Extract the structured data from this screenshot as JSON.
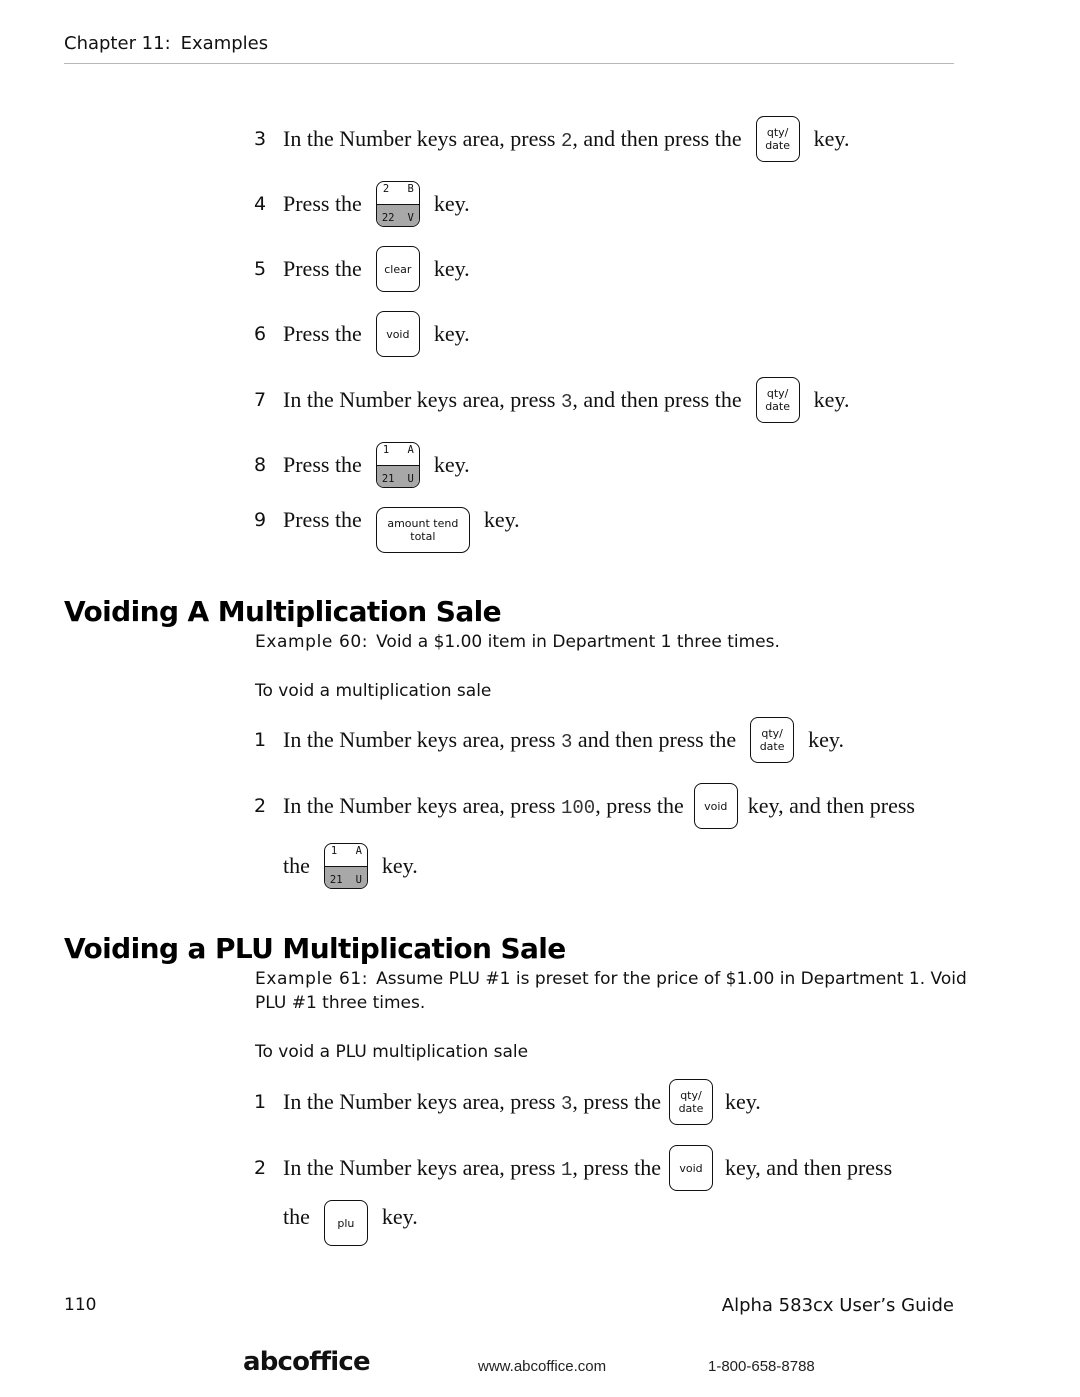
{
  "header": {
    "chapter": "Chapter 11:",
    "chapter_title": "Examples"
  },
  "keys": {
    "qty_date": [
      "qty/",
      "date"
    ],
    "clear": "clear",
    "void": "void",
    "plu": "plu",
    "amount_tend_total": [
      "amount tend",
      "total"
    ],
    "key_2b": {
      "top_left": "2",
      "top_right": "B",
      "bottom_left": "22",
      "bottom_right": "V"
    },
    "key_1a": {
      "top_left": "1",
      "top_right": "A",
      "bottom_left": "21",
      "bottom_right": "U"
    }
  },
  "words": {
    "key": "key.",
    "key_comma_then_press": "key, and then press",
    "the": "the"
  },
  "top_steps": [
    {
      "num": "3",
      "pre": "In the Number keys area, press ",
      "code": "2",
      "post": ", and then press the"
    },
    {
      "num": "4",
      "pre": "Press the"
    },
    {
      "num": "5",
      "pre": "Press the"
    },
    {
      "num": "6",
      "pre": "Press the"
    },
    {
      "num": "7",
      "pre": "In the Number keys area, press ",
      "code": "3",
      "post": ", and then press the"
    },
    {
      "num": "8",
      "pre": "Press the"
    },
    {
      "num": "9",
      "pre": "Press the"
    }
  ],
  "section1": {
    "title": "Voiding A Multiplication Sale",
    "example_label": "Example 60:",
    "example_text": "Void a $1.00 item in Department 1 three times.",
    "procedure": "To void a multiplication sale",
    "steps": [
      {
        "num": "1",
        "pre": "In the Number keys area, press ",
        "code": "3",
        "post": " and then press the"
      },
      {
        "num": "2",
        "pre": "In the Number keys area, press ",
        "code": "100",
        "post": ", press the"
      }
    ]
  },
  "section2": {
    "title": "Voiding a PLU Multiplication Sale",
    "example_label": "Example 61:",
    "example_text": "Assume PLU #1 is preset for the price of $1.00 in Department 1. Void PLU #1 three times.",
    "procedure": "To void a PLU multiplication sale",
    "steps": [
      {
        "num": "1",
        "pre": "In the Number keys area, press ",
        "code": "3",
        "post": ", press the"
      },
      {
        "num": "2",
        "pre": "In the Number keys area, press ",
        "code": "1",
        "post": ", press the"
      }
    ]
  },
  "footer": {
    "page_number": "110",
    "guide_title": "Alpha 583cx  User’s Guide",
    "brand": "abcoffice",
    "url": "www.abcoffice.com",
    "phone": "1-800-658-8788"
  }
}
